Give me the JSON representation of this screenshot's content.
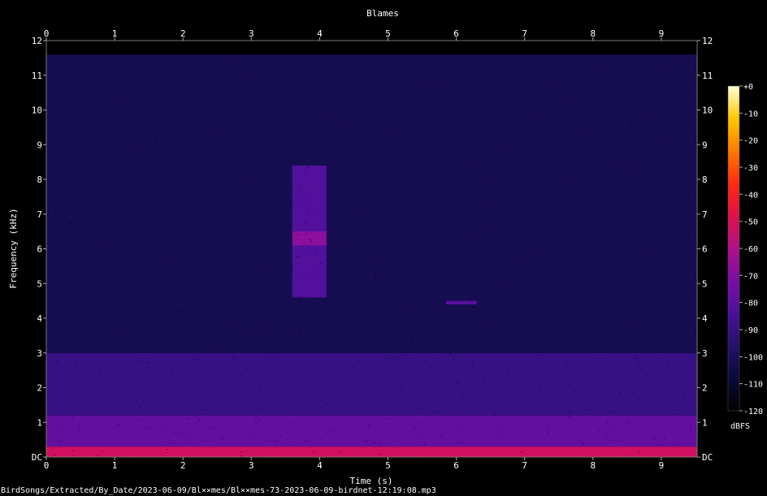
{
  "chart_data": {
    "type": "heatmap",
    "title": "Blames",
    "xlabel": "Time (s)",
    "ylabel": "Frequency (kHz)",
    "xlim": [
      0,
      9.55
    ],
    "ylim": [
      0,
      12
    ],
    "x_ticks": [
      "0",
      "1",
      "2",
      "3",
      "4",
      "5",
      "6",
      "7",
      "8",
      "9"
    ],
    "y_ticks": [
      "DC",
      "1",
      "2",
      "3",
      "4",
      "5",
      "6",
      "7",
      "8",
      "9",
      "10",
      "11",
      "12"
    ],
    "colorbar": {
      "label": "dBFS",
      "ticks": [
        "+0",
        "-10",
        "-20",
        "-30",
        "-40",
        "-50",
        "-60",
        "-70",
        "-80",
        "-90",
        "-100",
        "-110",
        "-120"
      ],
      "range": [
        -120,
        0
      ],
      "colors": [
        "#000000",
        "#0a0a3a",
        "#24106e",
        "#4a109a",
        "#7a0ea6",
        "#b0108a",
        "#e0104a",
        "#ff2a10",
        "#ff7a00",
        "#ffc800",
        "#ffffd8"
      ]
    },
    "regions": [
      {
        "t0": 0.0,
        "t1": 9.55,
        "f0": 0.0,
        "f1": 0.3,
        "dbfs": -52
      },
      {
        "t0": 0.0,
        "t1": 9.55,
        "f0": 0.3,
        "f1": 1.2,
        "dbfs": -78
      },
      {
        "t0": 0.0,
        "t1": 9.55,
        "f0": 1.2,
        "f1": 3.0,
        "dbfs": -90
      },
      {
        "t0": 0.0,
        "t1": 9.55,
        "f0": 3.0,
        "f1": 11.6,
        "dbfs": -103
      },
      {
        "t0": 3.6,
        "t1": 4.1,
        "f0": 4.6,
        "f1": 8.4,
        "dbfs": -82
      },
      {
        "t0": 3.6,
        "t1": 4.1,
        "f0": 6.1,
        "f1": 6.5,
        "dbfs": -68
      },
      {
        "t0": 5.85,
        "t1": 6.3,
        "f0": 4.4,
        "f1": 4.5,
        "dbfs": -80
      }
    ]
  },
  "footer": {
    "file_path": "BirdSongs/Extracted/By_Date/2023-06-09/Bl××mes/Bl××mes-73-2023-06-09-birdnet-12:19:08.mp3"
  }
}
